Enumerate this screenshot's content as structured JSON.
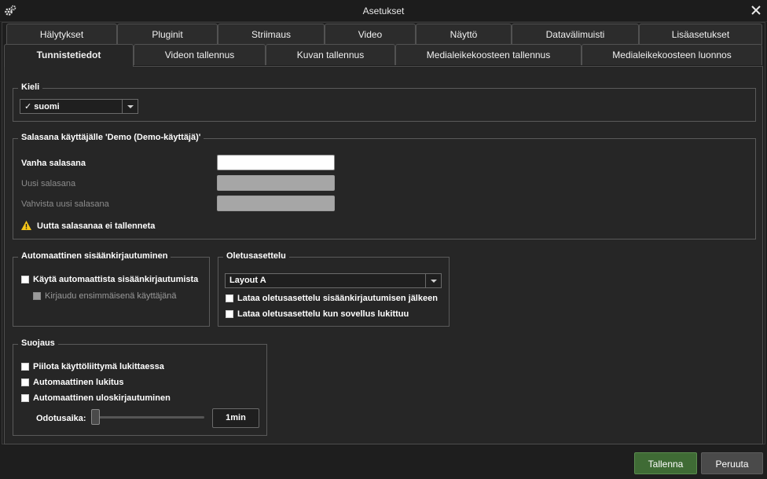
{
  "window": {
    "title": "Asetukset"
  },
  "tabs_row1": [
    "Hälytykset",
    "Pluginit",
    "Striimaus",
    "Video",
    "Näyttö",
    "Datavälimuisti",
    "Lisäasetukset"
  ],
  "tabs_row2": [
    "Tunnistetiedot",
    "Videon tallennus",
    "Kuvan tallennus",
    "Medialeikekoosteen tallennus",
    "Medialeikekoosteen luonnos"
  ],
  "active_tab": "Tunnistetiedot",
  "language": {
    "legend": "Kieli",
    "selected": "✓ suomi"
  },
  "password": {
    "legend": "Salasana käyttäjälle 'Demo (Demo-käyttäjä)'",
    "old_label": "Vanha salasana",
    "new_label": "Uusi salasana",
    "confirm_label": "Vahvista uusi salasana",
    "old_value": "",
    "new_value": "",
    "confirm_value": "",
    "warning": "Uutta salasanaa ei tallenneta"
  },
  "autologin": {
    "legend": "Automaattinen sisäänkirjautuminen",
    "use_label": "Käytä automaattista sisäänkirjautumista",
    "use_checked": false,
    "first_user_label": "Kirjaudu ensimmäisenä käyttäjänä",
    "first_user_checked": false
  },
  "default_layout": {
    "legend": "Oletusasettelu",
    "selected": "Layout A",
    "load_after_login_label": "Lataa oletusasettelu sisäänkirjautumisen jälkeen",
    "load_after_login_checked": false,
    "load_on_unlock_label": "Lataa oletusasettelu kun sovellus lukittuu",
    "load_on_unlock_checked": false
  },
  "protection": {
    "legend": "Suojaus",
    "hide_ui_label": "Piilota käyttöliittymä lukittaessa",
    "hide_ui_checked": false,
    "auto_lock_label": "Automaattinen lukitus",
    "auto_lock_checked": false,
    "auto_logout_label": "Automaattinen uloskirjautuminen",
    "auto_logout_checked": false,
    "wait_label": "Odotusaika:",
    "wait_value": "1min",
    "wait_slider_fraction": 0
  },
  "buttons": {
    "save": "Tallenna",
    "cancel": "Peruuta"
  },
  "colors": {
    "primary_button": "#3f6b35",
    "warning_icon": "#f5c518",
    "background": "#262626"
  },
  "icons": {
    "window": "gear-icon",
    "close": "close-icon",
    "warning": "warning-icon"
  }
}
